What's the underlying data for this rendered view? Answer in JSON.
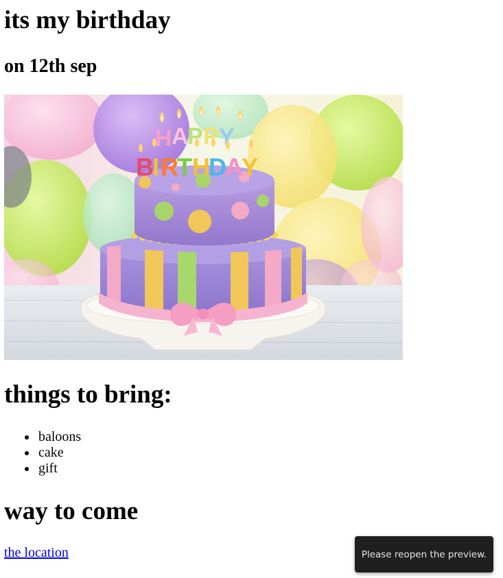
{
  "page": {
    "title": "its my birthday",
    "subtitle": "on 12th sep"
  },
  "image": {
    "subject": "birthday-cake",
    "cake_topper_text": "HAPPY BIRTHDAY",
    "colors": {
      "background_balloons": [
        "#f3a6c8",
        "#c7e86a",
        "#b48ee8",
        "#f7e58a",
        "#9fe0b0"
      ],
      "cake_top_tier": "#a98ad6",
      "cake_bottom_tier": "#9b83d8",
      "cake_stripes": [
        "#f2c75a",
        "#a7d86b",
        "#f4a9c6"
      ],
      "ribbon": "#f6b3cf",
      "plate": "#f4f1ec"
    }
  },
  "things": {
    "heading": "things to bring:",
    "items": [
      {
        "label": "baloons"
      },
      {
        "label": "cake"
      },
      {
        "label": "gift"
      }
    ]
  },
  "way": {
    "heading": "way to come",
    "link_text": "the location"
  },
  "toast": {
    "message": "Please reopen the preview."
  },
  "colors": {
    "link": "#0000ee",
    "toast_bg": "#1f1f1f",
    "toast_text": "#e6e6e6"
  }
}
